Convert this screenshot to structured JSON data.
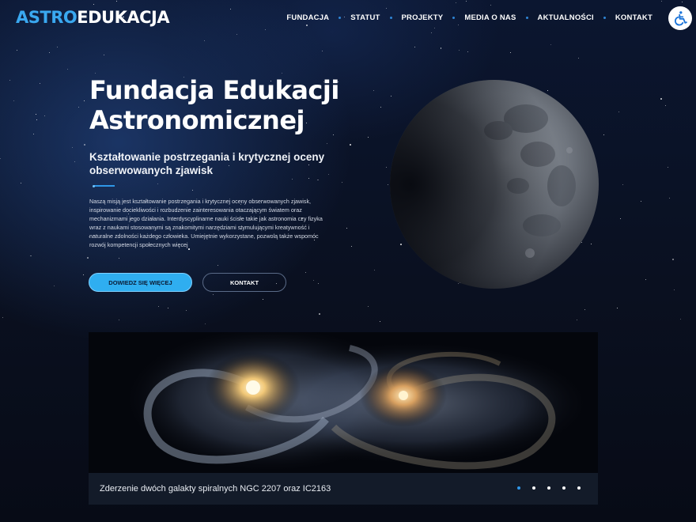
{
  "header": {
    "logo_part1": "ASTRO",
    "logo_part2": "EDUKACJA",
    "nav": [
      {
        "label": "FUNDACJA"
      },
      {
        "label": "STATUT"
      },
      {
        "label": "PROJEKTY"
      },
      {
        "label": "MEDIA O NAS"
      },
      {
        "label": "AKTUALNOŚCI"
      },
      {
        "label": "KONTAKT"
      }
    ],
    "accessibility_icon": "wheelchair-icon"
  },
  "hero": {
    "title_line1": "Fundacja Edukacji",
    "title_line2": "Astronomicznej",
    "subtitle": "Kształtowanie postrzegania i krytycznej oceny obserwowanych zjawisk",
    "description": "Naszą misją jest kształtowanie postrzegania i krytycznej oceny obserwowanych zjawisk, inspirowanie dociekliwości i rozbudzenie zainteresowania otaczającym światem oraz mechanizmami jego działania. Interdyscyplinarne nauki ścisłe takie jak astronomia czy fizyka wraz z naukami stosowanymi są znakomitymi narzędziami stymulującymi kreatywność i naturalne zdolności każdego człowieka. Umiejętnie wykorzystane, pozwolą także wspomóc rozwój kompetencji społecznych więcej",
    "primary_button": "DOWIEDZ SIĘ WIĘCEJ",
    "secondary_button": "KONTAKT"
  },
  "gallery": {
    "caption": "Zderzenie dwóch galakty spiralnych NGC 2207 oraz IC2163",
    "slides_total": 5,
    "active_index": 0
  },
  "colors": {
    "accent": "#2f97e8",
    "logo_blue": "#3aa8f0",
    "background": "#070b16",
    "caption_bar": "#131b29"
  }
}
